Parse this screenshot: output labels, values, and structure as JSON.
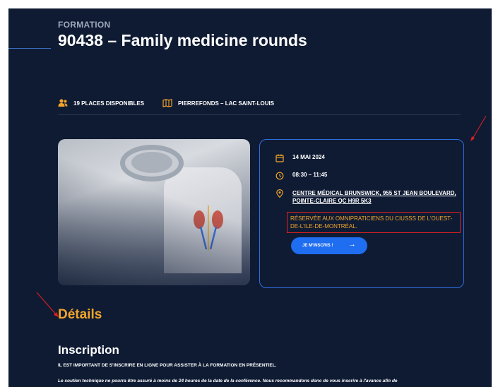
{
  "header": {
    "eyebrow": "FORMATION",
    "title": "90438 – Family medicine rounds"
  },
  "meta": {
    "places": "19 PLACES DISPONIBLES",
    "location": "PIERREFONDS – LAC SAINT-LOUIS"
  },
  "card": {
    "date": "14 MAI 2024",
    "time": "08:30 – 11:45",
    "address": "CENTRE MÉDICAL BRUNSWICK, 955 ST JEAN BOULEVARD, POINTE-CLAIRE QC H9R 5K3",
    "notice": "RÉSERVÉE AUX OMNIPRATICIENS DU CIUSSS DE L'OUEST-DE-L'ILE-DE-MONTRÉAL.",
    "cta_label": "JE M'INSCRIS !",
    "cta_arrow": "→"
  },
  "details": {
    "title": "Détails"
  },
  "inscription": {
    "title": "Inscription",
    "line1": "IL EST IMPORTANT DE S'INSCRIRE EN LIGNE POUR ASSISTER À LA FORMATION EN PRÉSENTIEL.",
    "line2": "Le soutien technique ne pourra être assuré à moins de 24 heures de la date de la conférence. Nous recommandons donc de vous inscrire à l'avance afin de"
  },
  "colors": {
    "background": "#0f1b33",
    "accent_orange": "#f2a52a",
    "accent_blue": "#1f6df0",
    "annotation_red": "#e02020"
  }
}
